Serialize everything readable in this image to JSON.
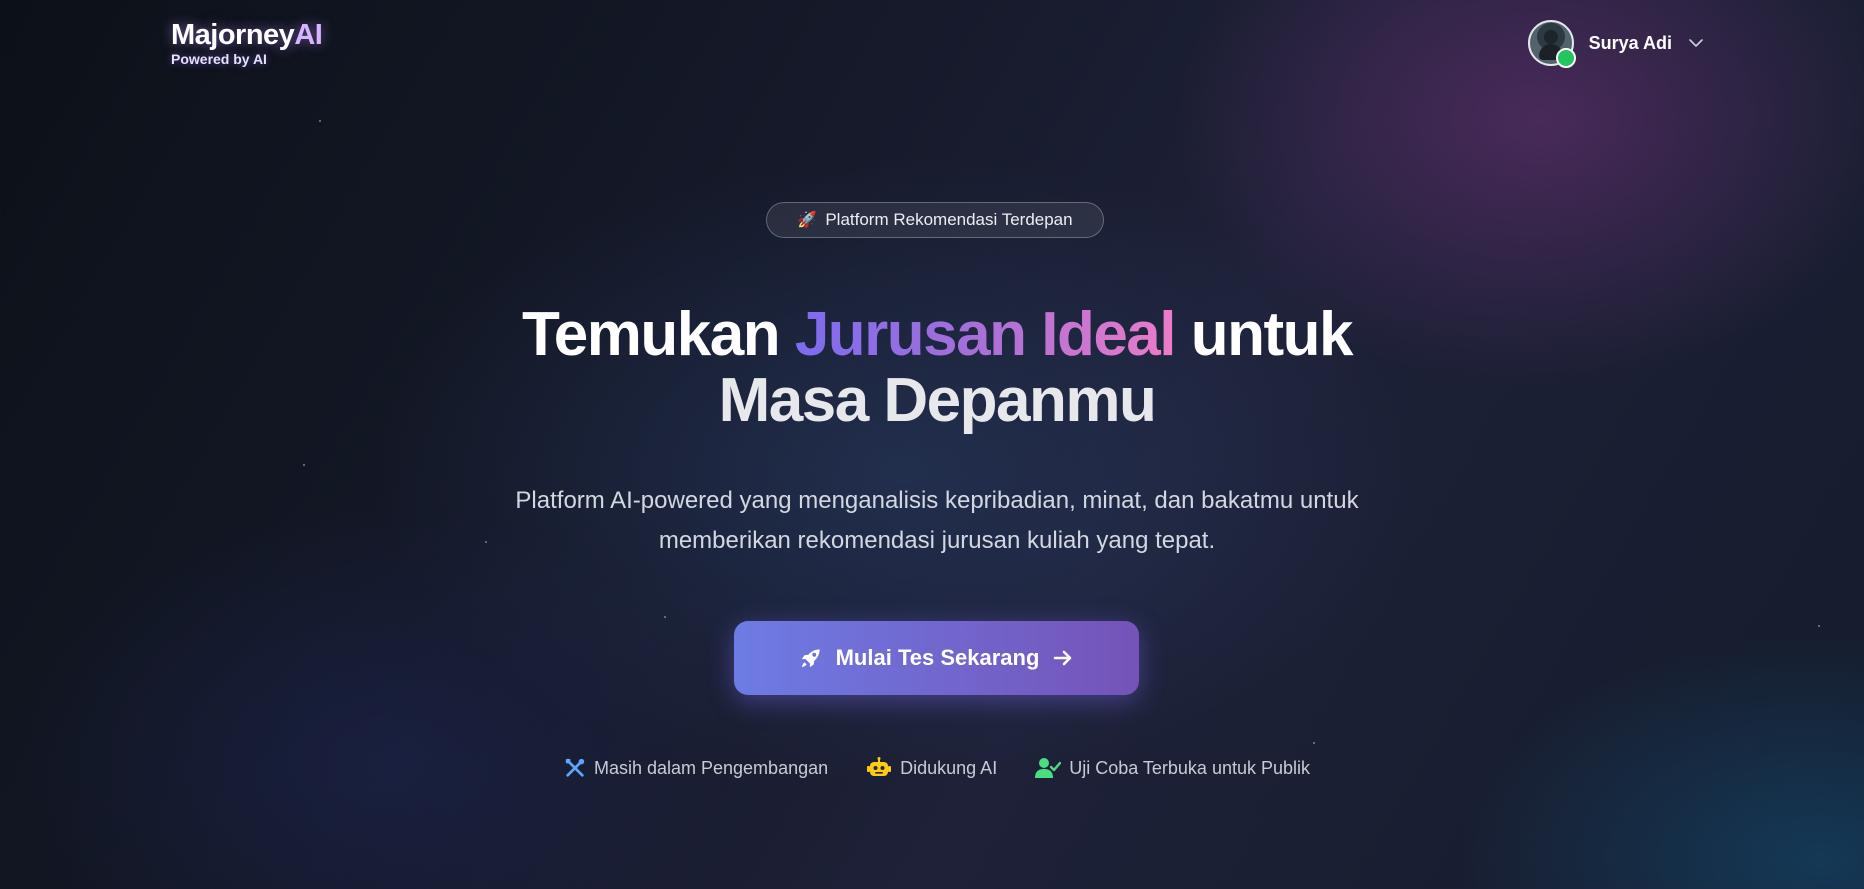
{
  "brand": {
    "name_main": "Majorney",
    "name_accent": "AI",
    "tagline": "Powered by AI"
  },
  "user": {
    "name": "Surya Adi",
    "status": "online",
    "menu_icon": "chevron-down-icon"
  },
  "hero": {
    "badge": {
      "emoji": "🚀",
      "text": "Platform Rekomendasi Terdepan"
    },
    "title_start": "Temukan",
    "title_highlight": "Jurusan Ideal",
    "title_end": "untuk",
    "title_line2": "Masa Depanmu",
    "subtitle_line1": "Platform AI-powered yang menganalisis kepribadian, minat, dan bakatmu untuk",
    "subtitle_line2": "memberikan rekomendasi jurusan kuliah yang tepat.",
    "cta": {
      "label": "Mulai Tes Sekarang",
      "icon_left": "rocket-icon",
      "icon_right": "arrow-right-icon"
    }
  },
  "features": [
    {
      "label": "Masih dalam Pengembangan",
      "icon": "tools-icon",
      "color": "#60a5fa"
    },
    {
      "label": "Didukung AI",
      "icon": "robot-icon",
      "color": "#facc15"
    },
    {
      "label": "Uji Coba Terbuka untuk Publik",
      "icon": "user-check-icon",
      "color": "#4ade80"
    }
  ],
  "colors": {
    "accent_start": "#6d7ce4",
    "accent_end": "#7553b8",
    "highlight_pink": "#ec7cc8",
    "online": "#22c55e"
  }
}
